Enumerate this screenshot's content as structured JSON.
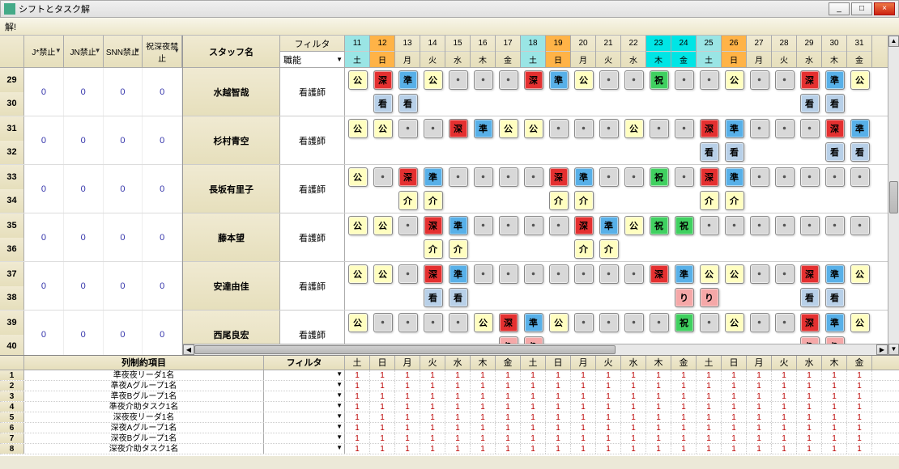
{
  "window": {
    "title": "シフトとタスク解",
    "toolbar": "解!"
  },
  "winbtns": {
    "min": "_",
    "max": "□",
    "close": "×"
  },
  "leftCols": [
    "J*禁止",
    "JN禁止",
    "SNN禁止",
    "祝深夜禁止"
  ],
  "leftRows": [
    {
      "nums": [
        "29",
        "30"
      ],
      "vals": [
        "0",
        "0",
        "0",
        "0"
      ]
    },
    {
      "nums": [
        "31",
        "32"
      ],
      "vals": [
        "0",
        "0",
        "0",
        "0"
      ]
    },
    {
      "nums": [
        "33",
        "34"
      ],
      "vals": [
        "0",
        "0",
        "0",
        "0"
      ]
    },
    {
      "nums": [
        "35",
        "36"
      ],
      "vals": [
        "0",
        "0",
        "0",
        "0"
      ]
    },
    {
      "nums": [
        "37",
        "38"
      ],
      "vals": [
        "0",
        "0",
        "0",
        "0"
      ]
    },
    {
      "nums": [
        "39",
        "40"
      ],
      "vals": [
        "0",
        "0",
        "0",
        "0"
      ]
    }
  ],
  "staffHdr": "スタッフ名",
  "filterHdr": "フィルタ",
  "filterVal": "職能",
  "days": [
    {
      "n": "11",
      "w": "土",
      "c": "sat"
    },
    {
      "n": "12",
      "w": "日",
      "c": "sun"
    },
    {
      "n": "13",
      "w": "月",
      "c": ""
    },
    {
      "n": "14",
      "w": "火",
      "c": ""
    },
    {
      "n": "15",
      "w": "水",
      "c": ""
    },
    {
      "n": "16",
      "w": "木",
      "c": ""
    },
    {
      "n": "17",
      "w": "金",
      "c": ""
    },
    {
      "n": "18",
      "w": "土",
      "c": "sat"
    },
    {
      "n": "19",
      "w": "日",
      "c": "sun"
    },
    {
      "n": "20",
      "w": "月",
      "c": ""
    },
    {
      "n": "21",
      "w": "火",
      "c": ""
    },
    {
      "n": "22",
      "w": "水",
      "c": ""
    },
    {
      "n": "23",
      "w": "木",
      "c": "hol"
    },
    {
      "n": "24",
      "w": "金",
      "c": "hol"
    },
    {
      "n": "25",
      "w": "土",
      "c": "sat"
    },
    {
      "n": "26",
      "w": "日",
      "c": "sun"
    },
    {
      "n": "27",
      "w": "月",
      "c": ""
    },
    {
      "n": "28",
      "w": "火",
      "c": ""
    },
    {
      "n": "29",
      "w": "水",
      "c": ""
    },
    {
      "n": "30",
      "w": "木",
      "c": ""
    },
    {
      "n": "31",
      "w": "金",
      "c": ""
    }
  ],
  "badges": {
    "kou": "公",
    "shin": "深",
    "jun": "準",
    "dot": "・",
    "kan": "看",
    "kai": "介",
    "shuku": "祝",
    "ri": "り"
  },
  "staff": [
    {
      "name": "水越智哉",
      "role": "看護師",
      "l1": [
        "kou",
        "shin",
        "jun",
        "kou",
        "dot",
        "dot",
        "dot",
        "shin",
        "jun",
        "kou",
        "dot",
        "dot",
        "shuku",
        "dot",
        "dot",
        "kou",
        "dot",
        "dot",
        "shin",
        "jun",
        "kou"
      ],
      "l2": [
        "",
        "kan",
        "kan",
        "",
        "",
        "",
        "",
        "",
        "",
        "",
        "",
        "",
        "",
        "",
        "",
        "",
        "",
        "",
        "kan",
        "kan",
        ""
      ]
    },
    {
      "name": "杉村青空",
      "role": "看護師",
      "l1": [
        "kou",
        "kou",
        "dot",
        "dot",
        "shin",
        "jun",
        "kou",
        "kou",
        "dot",
        "dot",
        "dot",
        "kou",
        "dot",
        "dot",
        "shin",
        "jun",
        "dot",
        "dot",
        "dot",
        "shin",
        "jun"
      ],
      "l2": [
        "",
        "",
        "",
        "",
        "",
        "",
        "",
        "",
        "",
        "",
        "",
        "",
        "",
        "",
        "kan",
        "kan",
        "",
        "",
        "",
        "kan",
        "kan"
      ]
    },
    {
      "name": "長坂有里子",
      "role": "看護師",
      "l1": [
        "kou",
        "dot",
        "shin",
        "jun",
        "dot",
        "dot",
        "dot",
        "dot",
        "shin",
        "jun",
        "dot",
        "dot",
        "shuku",
        "dot",
        "shin",
        "jun",
        "dot",
        "dot",
        "dot",
        "dot",
        "dot"
      ],
      "l2": [
        "",
        "",
        "kai",
        "kai",
        "",
        "",
        "",
        "",
        "kai",
        "kai",
        "",
        "",
        "",
        "",
        "kai",
        "kai",
        "",
        "",
        "",
        "",
        ""
      ]
    },
    {
      "name": "藤本望",
      "role": "看護師",
      "l1": [
        "kou",
        "kou",
        "dot",
        "shin",
        "jun",
        "dot",
        "dot",
        "dot",
        "dot",
        "shin",
        "jun",
        "kou",
        "shuku",
        "shuku",
        "dot",
        "dot",
        "dot",
        "dot",
        "dot",
        "dot",
        "dot"
      ],
      "l2": [
        "",
        "",
        "",
        "kai",
        "kai",
        "",
        "",
        "",
        "",
        "kai",
        "kai",
        "",
        "",
        "",
        "",
        "",
        "",
        "",
        "",
        "",
        ""
      ]
    },
    {
      "name": "安達由佳",
      "role": "看護師",
      "l1": [
        "kou",
        "kou",
        "dot",
        "shin",
        "jun",
        "dot",
        "dot",
        "dot",
        "dot",
        "dot",
        "dot",
        "dot",
        "shin",
        "jun",
        "kou",
        "kou",
        "dot",
        "dot",
        "shin",
        "jun",
        "kou"
      ],
      "l2": [
        "",
        "",
        "",
        "kan",
        "kan",
        "",
        "",
        "",
        "",
        "",
        "",
        "",
        "",
        "ri",
        "ri",
        "",
        "",
        "",
        "kan",
        "kan",
        ""
      ]
    },
    {
      "name": "西尾良宏",
      "role": "看護師",
      "l1": [
        "kou",
        "dot",
        "dot",
        "dot",
        "dot",
        "kou",
        "shin",
        "jun",
        "kou",
        "dot",
        "dot",
        "dot",
        "dot",
        "shuku",
        "dot",
        "kou",
        "dot",
        "dot",
        "shin",
        "jun",
        "kou"
      ],
      "l2": [
        "",
        "",
        "",
        "",
        "",
        "",
        "ri",
        "ri",
        "",
        "",
        "",
        "",
        "",
        "",
        "",
        "",
        "",
        "",
        "ri",
        "ri",
        ""
      ]
    }
  ],
  "bottomHdr": {
    "col": "列制約項目",
    "filter": "フィルタ"
  },
  "bottomDays": [
    "土",
    "日",
    "月",
    "火",
    "水",
    "木",
    "金",
    "土",
    "日",
    "月",
    "火",
    "水",
    "木",
    "金",
    "土",
    "日",
    "月",
    "火",
    "水",
    "木",
    "金"
  ],
  "bottomRows": [
    {
      "n": "1",
      "lbl": "準夜夜リーダ1名"
    },
    {
      "n": "2",
      "lbl": "準夜Aグループ1名"
    },
    {
      "n": "3",
      "lbl": "準夜Bグループ1名"
    },
    {
      "n": "4",
      "lbl": "準夜介助タスク1名"
    },
    {
      "n": "5",
      "lbl": "深夜夜リーダ1名"
    },
    {
      "n": "6",
      "lbl": "深夜Aグループ1名"
    },
    {
      "n": "7",
      "lbl": "深夜Bグループ1名"
    },
    {
      "n": "8",
      "lbl": "深夜介助タスク1名"
    }
  ],
  "one": "1"
}
